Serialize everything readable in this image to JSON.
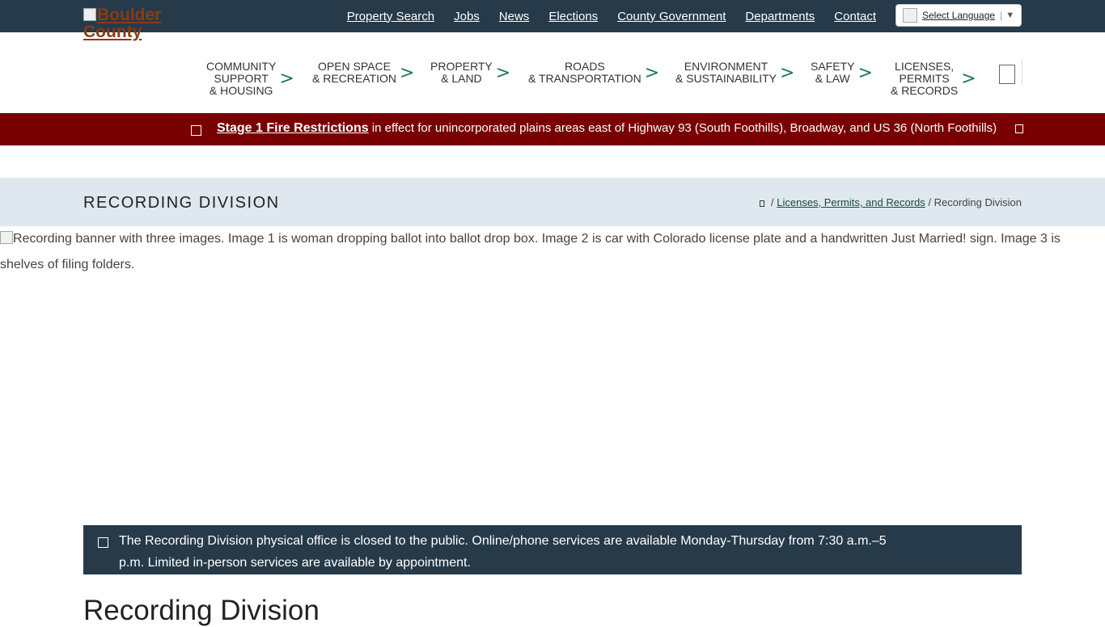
{
  "header": {
    "logo_text": "Boulder County",
    "top_links": [
      "Property Search",
      "Jobs",
      "News",
      "Elections",
      "County Government",
      "Departments",
      "Contact"
    ],
    "language": {
      "label": "Select Language",
      "arrow": "▼"
    }
  },
  "main_nav": {
    "items": [
      {
        "line1": "COMMUNITY",
        "line2": "SUPPORT",
        "line3": "& HOUSING"
      },
      {
        "line1": "OPEN SPACE",
        "line2": "& RECREATION",
        "line3": ""
      },
      {
        "line1": "PROPERTY",
        "line2": "& LAND",
        "line3": ""
      },
      {
        "line1": "ROADS",
        "line2": "& TRANSPORTATION",
        "line3": ""
      },
      {
        "line1": "ENVIRONMENT",
        "line2": "& SUSTAINABILITY",
        "line3": ""
      },
      {
        "line1": "SAFETY",
        "line2": "& LAW",
        "line3": ""
      },
      {
        "line1": "LICENSES,",
        "line2": "PERMITS",
        "line3": "& RECORDS"
      }
    ],
    "chevron": ">"
  },
  "alert": {
    "link_text": "Stage 1 Fire Restrictions",
    "rest_text": " in effect for unincorporated plains areas east of Highway 93 (South Foothills), Broadway, and US 36 (North Foothills)",
    "color": "#780000"
  },
  "title_band": {
    "title": "Recording Division",
    "breadcrumb": {
      "sep": " / ",
      "link": "Licenses, Permits, and Records",
      "current": "Recording Division"
    }
  },
  "banner": {
    "alt_text": "Recording banner with three images. Image 1 is woman dropping ballot into ballot drop box. Image 2 is car with Colorado license plate and a handwritten Just Married! sign. Image 3 is shelves of filing folders."
  },
  "notice": {
    "text": "The Recording Division physical office is closed to the public. Online/phone services are available Monday-Thursday from 7:30 a.m.–5 p.m. Limited in-person services are available by appointment."
  },
  "page_heading": "Recording Division",
  "colors": {
    "dark_blue": "#263a49",
    "accent_green": "#1a7a5a",
    "title_band": "#e0e8ef"
  }
}
